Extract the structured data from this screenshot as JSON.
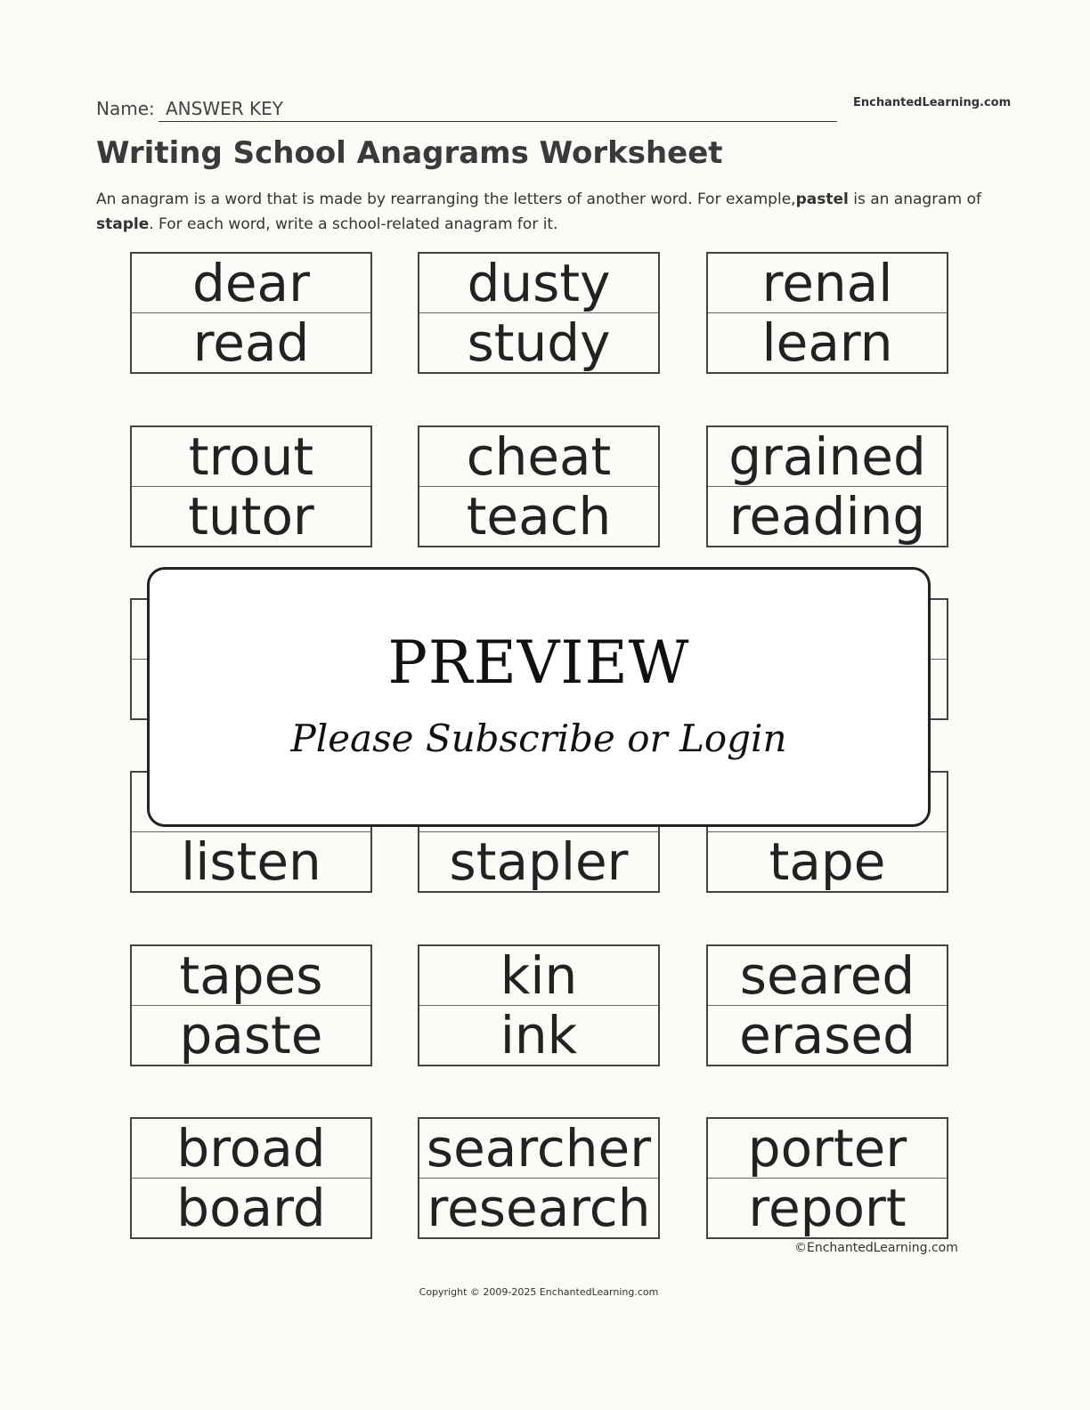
{
  "header": {
    "name_label": "Name:",
    "name_value": "ANSWER KEY",
    "brand": "EnchantedLearning.com"
  },
  "title": "Writing School Anagrams Worksheet",
  "intro": {
    "part1": "An anagram is a word that is made by rearranging the letters of another word. For example,",
    "bold1": "pastel",
    "part2": " is an anagram of ",
    "bold2": "staple",
    "part3": ". For each word, write a school-related anagram for it."
  },
  "boxes": [
    {
      "top": "dear",
      "bottom": "read"
    },
    {
      "top": "dusty",
      "bottom": "study"
    },
    {
      "top": "renal",
      "bottom": "learn"
    },
    {
      "top": "trout",
      "bottom": "tutor"
    },
    {
      "top": "cheat",
      "bottom": "teach"
    },
    {
      "top": "grained",
      "bottom": "reading"
    },
    {
      "top": "",
      "bottom": ""
    },
    {
      "top": "",
      "bottom": ""
    },
    {
      "top": "",
      "bottom": ""
    },
    {
      "top": "",
      "bottom": "listen"
    },
    {
      "top": "",
      "bottom": "stapler"
    },
    {
      "top": "",
      "bottom": "tape"
    },
    {
      "top": "tapes",
      "bottom": "paste"
    },
    {
      "top": "kin",
      "bottom": "ink"
    },
    {
      "top": "seared",
      "bottom": "erased"
    },
    {
      "top": "broad",
      "bottom": "board"
    },
    {
      "top": "searcher",
      "bottom": "research"
    },
    {
      "top": "porter",
      "bottom": "report"
    }
  ],
  "credit": "©EnchantedLearning.com",
  "overlay": {
    "title": "PREVIEW",
    "subtitle": "Please Subscribe or Login"
  },
  "copyright": "Copyright © 2009-2025 EnchantedLearning.com"
}
